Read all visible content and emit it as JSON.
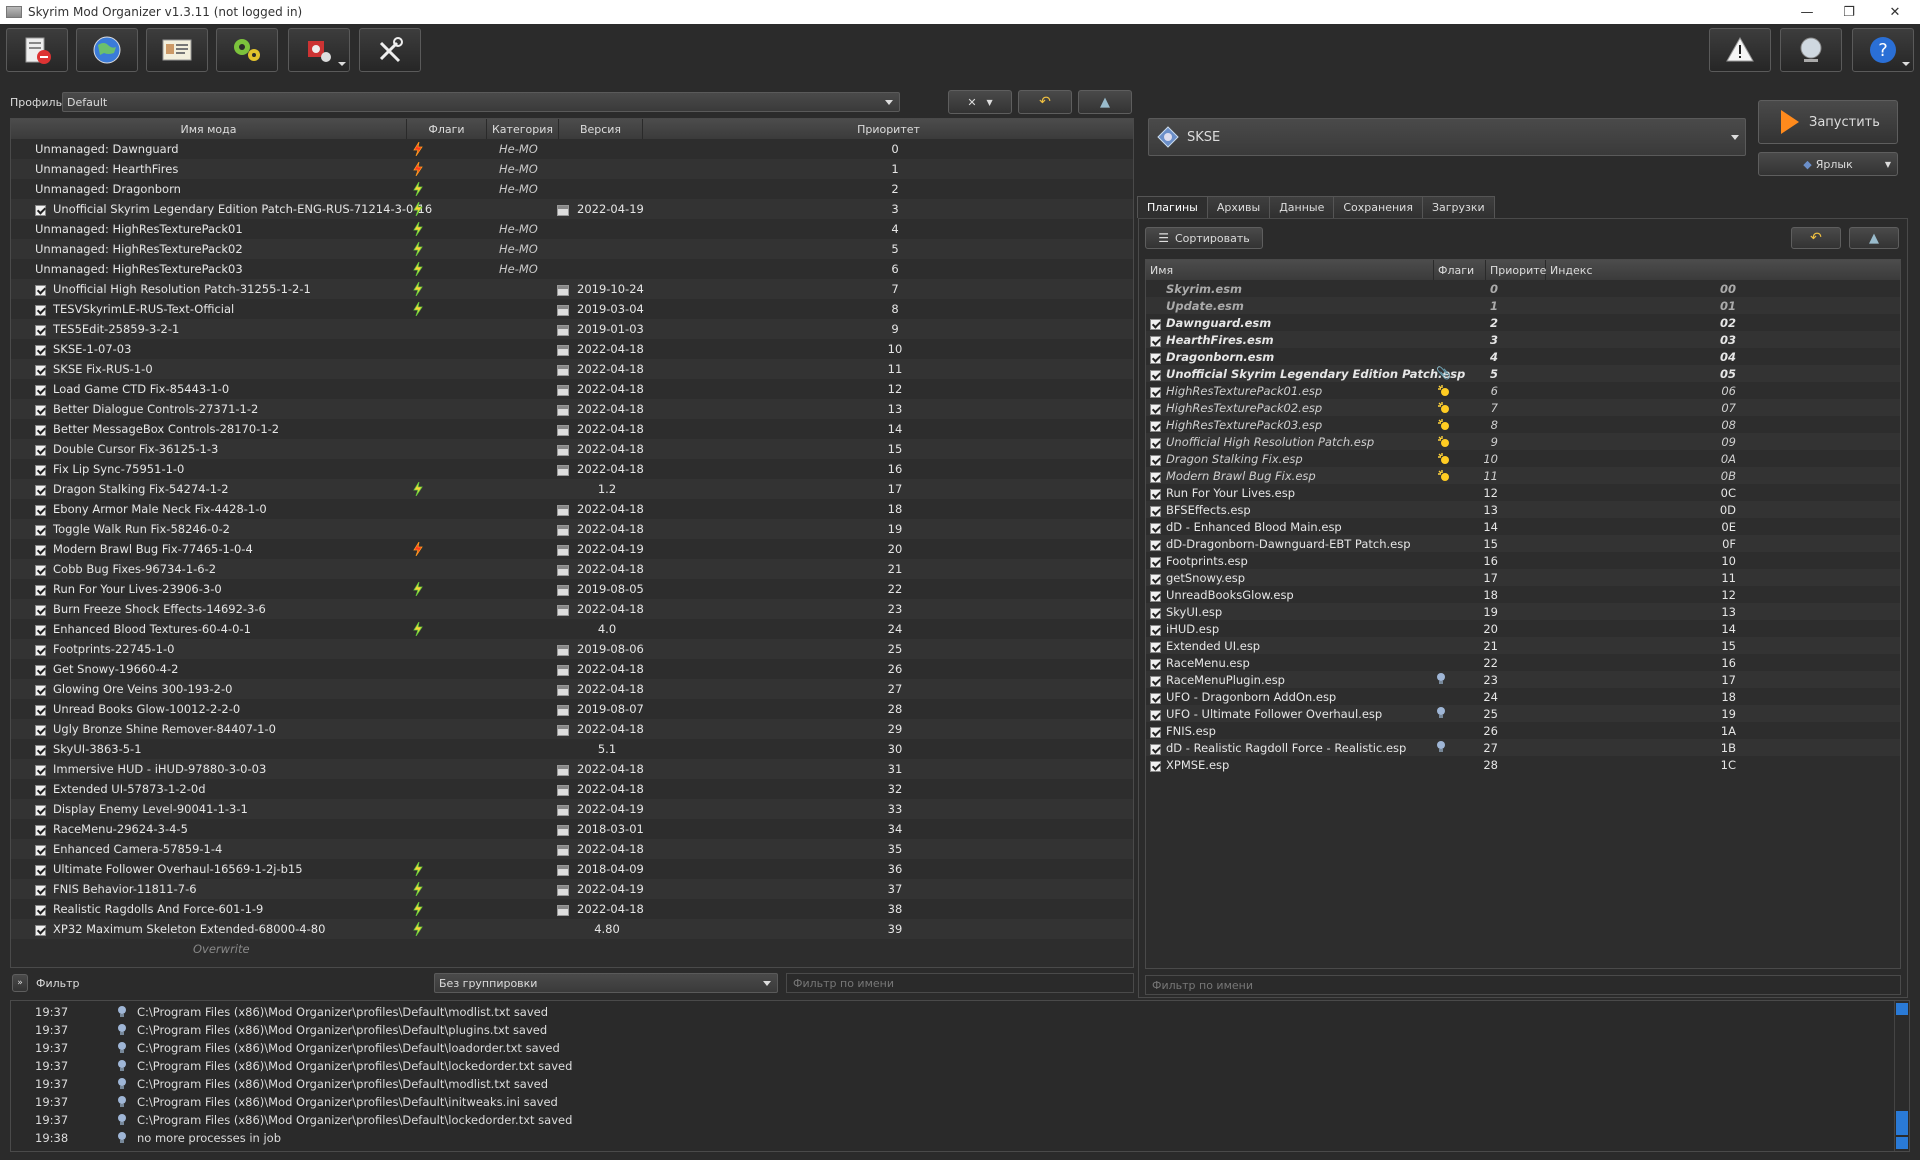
{
  "window": {
    "title": "Skyrim Mod Organizer v1.3.11 (not logged in)"
  },
  "profile": {
    "label": "Профиль",
    "value": "Default"
  },
  "mods": {
    "columns": [
      "Имя мода",
      "Флаги",
      "Категория",
      "Версия",
      "Приоритет"
    ],
    "rows": [
      {
        "name": "Unmanaged: Dawnguard",
        "check": false,
        "flag": "red",
        "cat": "Не-МО",
        "ver": "",
        "cal": false,
        "pri": "0"
      },
      {
        "name": "Unmanaged: HearthFires",
        "check": false,
        "flag": "red",
        "cat": "Не-МО",
        "ver": "",
        "cal": false,
        "pri": "1"
      },
      {
        "name": "Unmanaged: Dragonborn",
        "check": false,
        "flag": "green",
        "cat": "Не-МО",
        "ver": "",
        "cal": false,
        "pri": "2"
      },
      {
        "name": "Unofficial Skyrim Legendary Edition Patch-ENG-RUS-71214-3-0-16",
        "check": true,
        "flag": "green",
        "cat": "",
        "ver": "2022-04-19",
        "cal": true,
        "pri": "3"
      },
      {
        "name": "Unmanaged: HighResTexturePack01",
        "check": false,
        "flag": "green",
        "cat": "Не-МО",
        "ver": "",
        "cal": false,
        "pri": "4"
      },
      {
        "name": "Unmanaged: HighResTexturePack02",
        "check": false,
        "flag": "green",
        "cat": "Не-МО",
        "ver": "",
        "cal": false,
        "pri": "5"
      },
      {
        "name": "Unmanaged: HighResTexturePack03",
        "check": false,
        "flag": "green",
        "cat": "Не-МО",
        "ver": "",
        "cal": false,
        "pri": "6"
      },
      {
        "name": "Unofficial High Resolution Patch-31255-1-2-1",
        "check": true,
        "flag": "green",
        "cat": "",
        "ver": "2019-10-24",
        "cal": true,
        "pri": "7"
      },
      {
        "name": "TESVSkyrimLE-RUS-Text-Official",
        "check": true,
        "flag": "green",
        "cat": "",
        "ver": "2019-03-04",
        "cal": true,
        "pri": "8"
      },
      {
        "name": "TES5Edit-25859-3-2-1",
        "check": true,
        "flag": "",
        "cat": "",
        "ver": "2019-01-03",
        "cal": true,
        "pri": "9"
      },
      {
        "name": "SKSE-1-07-03",
        "check": true,
        "flag": "",
        "cat": "",
        "ver": "2022-04-18",
        "cal": true,
        "pri": "10"
      },
      {
        "name": "SKSE Fix-RUS-1-0",
        "check": true,
        "flag": "",
        "cat": "",
        "ver": "2022-04-18",
        "cal": true,
        "pri": "11"
      },
      {
        "name": "Load Game CTD Fix-85443-1-0",
        "check": true,
        "flag": "",
        "cat": "",
        "ver": "2022-04-18",
        "cal": true,
        "pri": "12"
      },
      {
        "name": "Better Dialogue Controls-27371-1-2",
        "check": true,
        "flag": "",
        "cat": "",
        "ver": "2022-04-18",
        "cal": true,
        "pri": "13"
      },
      {
        "name": "Better MessageBox Controls-28170-1-2",
        "check": true,
        "flag": "",
        "cat": "",
        "ver": "2022-04-18",
        "cal": true,
        "pri": "14"
      },
      {
        "name": "Double Cursor Fix-36125-1-3",
        "check": true,
        "flag": "",
        "cat": "",
        "ver": "2022-04-18",
        "cal": true,
        "pri": "15"
      },
      {
        "name": "Fix Lip Sync-75951-1-0",
        "check": true,
        "flag": "",
        "cat": "",
        "ver": "2022-04-18",
        "cal": true,
        "pri": "16"
      },
      {
        "name": "Dragon Stalking Fix-54274-1-2",
        "check": true,
        "flag": "green",
        "cat": "",
        "ver": "1.2",
        "cal": false,
        "pri": "17"
      },
      {
        "name": "Ebony Armor Male Neck Fix-4428-1-0",
        "check": true,
        "flag": "",
        "cat": "",
        "ver": "2022-04-18",
        "cal": true,
        "pri": "18"
      },
      {
        "name": "Toggle Walk Run Fix-58246-0-2",
        "check": true,
        "flag": "",
        "cat": "",
        "ver": "2022-04-18",
        "cal": true,
        "pri": "19"
      },
      {
        "name": "Modern Brawl Bug Fix-77465-1-0-4",
        "check": true,
        "flag": "red",
        "cat": "",
        "ver": "2022-04-19",
        "cal": true,
        "pri": "20"
      },
      {
        "name": "Cobb Bug Fixes-96734-1-6-2",
        "check": true,
        "flag": "",
        "cat": "",
        "ver": "2022-04-18",
        "cal": true,
        "pri": "21"
      },
      {
        "name": "Run For Your Lives-23906-3-0",
        "check": true,
        "flag": "green",
        "cat": "",
        "ver": "2019-08-05",
        "cal": true,
        "pri": "22"
      },
      {
        "name": "Burn Freeze Shock Effects-14692-3-6",
        "check": true,
        "flag": "",
        "cat": "",
        "ver": "2022-04-18",
        "cal": true,
        "pri": "23"
      },
      {
        "name": "Enhanced Blood Textures-60-4-0-1",
        "check": true,
        "flag": "green",
        "cat": "",
        "ver": "4.0",
        "cal": false,
        "pri": "24"
      },
      {
        "name": "Footprints-22745-1-0",
        "check": true,
        "flag": "",
        "cat": "",
        "ver": "2019-08-06",
        "cal": true,
        "pri": "25"
      },
      {
        "name": "Get Snowy-19660-4-2",
        "check": true,
        "flag": "",
        "cat": "",
        "ver": "2022-04-18",
        "cal": true,
        "pri": "26"
      },
      {
        "name": "Glowing Ore Veins 300-193-2-0",
        "check": true,
        "flag": "",
        "cat": "",
        "ver": "2022-04-18",
        "cal": true,
        "pri": "27"
      },
      {
        "name": "Unread Books Glow-10012-2-2-0",
        "check": true,
        "flag": "",
        "cat": "",
        "ver": "2019-08-07",
        "cal": true,
        "pri": "28"
      },
      {
        "name": "Ugly Bronze Shine Remover-84407-1-0",
        "check": true,
        "flag": "",
        "cat": "",
        "ver": "2022-04-18",
        "cal": true,
        "pri": "29"
      },
      {
        "name": "SkyUI-3863-5-1",
        "check": true,
        "flag": "",
        "cat": "",
        "ver": "5.1",
        "cal": false,
        "pri": "30"
      },
      {
        "name": "Immersive HUD - iHUD-97880-3-0-03",
        "check": true,
        "flag": "",
        "cat": "",
        "ver": "2022-04-18",
        "cal": true,
        "pri": "31"
      },
      {
        "name": "Extended UI-57873-1-2-0d",
        "check": true,
        "flag": "",
        "cat": "",
        "ver": "2022-04-18",
        "cal": true,
        "pri": "32"
      },
      {
        "name": "Display Enemy Level-90041-1-3-1",
        "check": true,
        "flag": "",
        "cat": "",
        "ver": "2022-04-19",
        "cal": true,
        "pri": "33"
      },
      {
        "name": "RaceMenu-29624-3-4-5",
        "check": true,
        "flag": "",
        "cat": "",
        "ver": "2018-03-01",
        "cal": true,
        "pri": "34"
      },
      {
        "name": "Enhanced Camera-57859-1-4",
        "check": true,
        "flag": "",
        "cat": "",
        "ver": "2022-04-18",
        "cal": true,
        "pri": "35"
      },
      {
        "name": "Ultimate Follower Overhaul-16569-1-2j-b15",
        "check": true,
        "flag": "green",
        "cat": "",
        "ver": "2018-04-09",
        "cal": true,
        "pri": "36"
      },
      {
        "name": "FNIS Behavior-11811-7-6",
        "check": true,
        "flag": "green",
        "cat": "",
        "ver": "2022-04-19",
        "cal": true,
        "pri": "37"
      },
      {
        "name": "Realistic Ragdolls And Force-601-1-9",
        "check": true,
        "flag": "green",
        "cat": "",
        "ver": "2022-04-18",
        "cal": true,
        "pri": "38"
      },
      {
        "name": "XP32 Maximum Skeleton Extended-68000-4-80",
        "check": true,
        "flag": "green",
        "cat": "",
        "ver": "4.80",
        "cal": false,
        "pri": "39"
      }
    ],
    "overwrite": "Overwrite"
  },
  "bottom_left": {
    "filter_label": "Фильтр",
    "grouping": "Без группировки",
    "name_filter_placeholder": "Фильтр по имени"
  },
  "executable": {
    "name": "SKSE",
    "run_label": "Запустить",
    "shortcut_label": "Ярлык"
  },
  "tabs": [
    "Плагины",
    "Архивы",
    "Данные",
    "Сохранения",
    "Загрузки"
  ],
  "plugins": {
    "sort_label": "Сортировать",
    "columns": [
      "Имя",
      "Флаги",
      "Приоритет",
      "Индекс"
    ],
    "rows": [
      {
        "name": "Skyrim.esm",
        "check": false,
        "style": "bold-grey",
        "flag": "",
        "pri": "0",
        "idx": "00"
      },
      {
        "name": "Update.esm",
        "check": false,
        "style": "bold-grey",
        "flag": "",
        "pri": "1",
        "idx": "01"
      },
      {
        "name": "Dawnguard.esm",
        "check": true,
        "style": "bold",
        "flag": "",
        "pri": "2",
        "idx": "02"
      },
      {
        "name": "HearthFires.esm",
        "check": true,
        "style": "bold",
        "flag": "",
        "pri": "3",
        "idx": "03"
      },
      {
        "name": "Dragonborn.esm",
        "check": true,
        "style": "bold",
        "flag": "",
        "pri": "4",
        "idx": "04"
      },
      {
        "name": "Unofficial Skyrim Legendary Edition Patch.esp",
        "check": true,
        "style": "bold",
        "flag": "clip",
        "pri": "5",
        "idx": "05"
      },
      {
        "name": "HighResTexturePack01.esp",
        "check": true,
        "style": "italic",
        "flag": "star",
        "pri": "6",
        "idx": "06"
      },
      {
        "name": "HighResTexturePack02.esp",
        "check": true,
        "style": "italic",
        "flag": "star",
        "pri": "7",
        "idx": "07"
      },
      {
        "name": "HighResTexturePack03.esp",
        "check": true,
        "style": "italic",
        "flag": "star",
        "pri": "8",
        "idx": "08"
      },
      {
        "name": "Unofficial High Resolution Patch.esp",
        "check": true,
        "style": "italic",
        "flag": "star",
        "pri": "9",
        "idx": "09"
      },
      {
        "name": "Dragon Stalking Fix.esp",
        "check": true,
        "style": "italic",
        "flag": "star",
        "pri": "10",
        "idx": "0A"
      },
      {
        "name": "Modern Brawl Bug Fix.esp",
        "check": true,
        "style": "italic",
        "flag": "star",
        "pri": "11",
        "idx": "0B"
      },
      {
        "name": "Run For Your Lives.esp",
        "check": true,
        "style": "",
        "flag": "",
        "pri": "12",
        "idx": "0C"
      },
      {
        "name": "BFSEffects.esp",
        "check": true,
        "style": "",
        "flag": "",
        "pri": "13",
        "idx": "0D"
      },
      {
        "name": "dD - Enhanced Blood Main.esp",
        "check": true,
        "style": "",
        "flag": "",
        "pri": "14",
        "idx": "0E"
      },
      {
        "name": "dD-Dragonborn-Dawnguard-EBT Patch.esp",
        "check": true,
        "style": "",
        "flag": "",
        "pri": "15",
        "idx": "0F"
      },
      {
        "name": "Footprints.esp",
        "check": true,
        "style": "",
        "flag": "",
        "pri": "16",
        "idx": "10"
      },
      {
        "name": "getSnowy.esp",
        "check": true,
        "style": "",
        "flag": "",
        "pri": "17",
        "idx": "11"
      },
      {
        "name": "UnreadBooksGlow.esp",
        "check": true,
        "style": "",
        "flag": "",
        "pri": "18",
        "idx": "12"
      },
      {
        "name": "SkyUI.esp",
        "check": true,
        "style": "",
        "flag": "",
        "pri": "19",
        "idx": "13"
      },
      {
        "name": "iHUD.esp",
        "check": true,
        "style": "",
        "flag": "",
        "pri": "20",
        "idx": "14"
      },
      {
        "name": "Extended UI.esp",
        "check": true,
        "style": "",
        "flag": "",
        "pri": "21",
        "idx": "15"
      },
      {
        "name": "RaceMenu.esp",
        "check": true,
        "style": "",
        "flag": "",
        "pri": "22",
        "idx": "16"
      },
      {
        "name": "RaceMenuPlugin.esp",
        "check": true,
        "style": "",
        "flag": "bulb",
        "pri": "23",
        "idx": "17"
      },
      {
        "name": "UFO - Dragonborn AddOn.esp",
        "check": true,
        "style": "",
        "flag": "",
        "pri": "24",
        "idx": "18"
      },
      {
        "name": "UFO - Ultimate Follower Overhaul.esp",
        "check": true,
        "style": "",
        "flag": "bulb",
        "pri": "25",
        "idx": "19"
      },
      {
        "name": "FNIS.esp",
        "check": true,
        "style": "",
        "flag": "",
        "pri": "26",
        "idx": "1A"
      },
      {
        "name": "dD - Realistic Ragdoll Force - Realistic.esp",
        "check": true,
        "style": "",
        "flag": "bulb",
        "pri": "27",
        "idx": "1B"
      },
      {
        "name": "XPMSE.esp",
        "check": true,
        "style": "",
        "flag": "",
        "pri": "28",
        "idx": "1C"
      }
    ],
    "name_filter_placeholder": "Фильтр по имени"
  },
  "log": [
    {
      "time": "19:37",
      "msg": "C:\\Program Files (x86)\\Mod Organizer\\profiles\\Default\\modlist.txt saved"
    },
    {
      "time": "19:37",
      "msg": "C:\\Program Files (x86)\\Mod Organizer\\profiles\\Default\\plugins.txt saved"
    },
    {
      "time": "19:37",
      "msg": "C:\\Program Files (x86)\\Mod Organizer\\profiles\\Default\\loadorder.txt saved"
    },
    {
      "time": "19:37",
      "msg": "C:\\Program Files (x86)\\Mod Organizer\\profiles\\Default\\lockedorder.txt saved"
    },
    {
      "time": "19:37",
      "msg": "C:\\Program Files (x86)\\Mod Organizer\\profiles\\Default\\modlist.txt saved"
    },
    {
      "time": "19:37",
      "msg": "C:\\Program Files (x86)\\Mod Organizer\\profiles\\Default\\initweaks.ini saved"
    },
    {
      "time": "19:37",
      "msg": "C:\\Program Files (x86)\\Mod Organizer\\profiles\\Default\\lockedorder.txt saved"
    },
    {
      "time": "19:38",
      "msg": "no more processes in job"
    }
  ]
}
